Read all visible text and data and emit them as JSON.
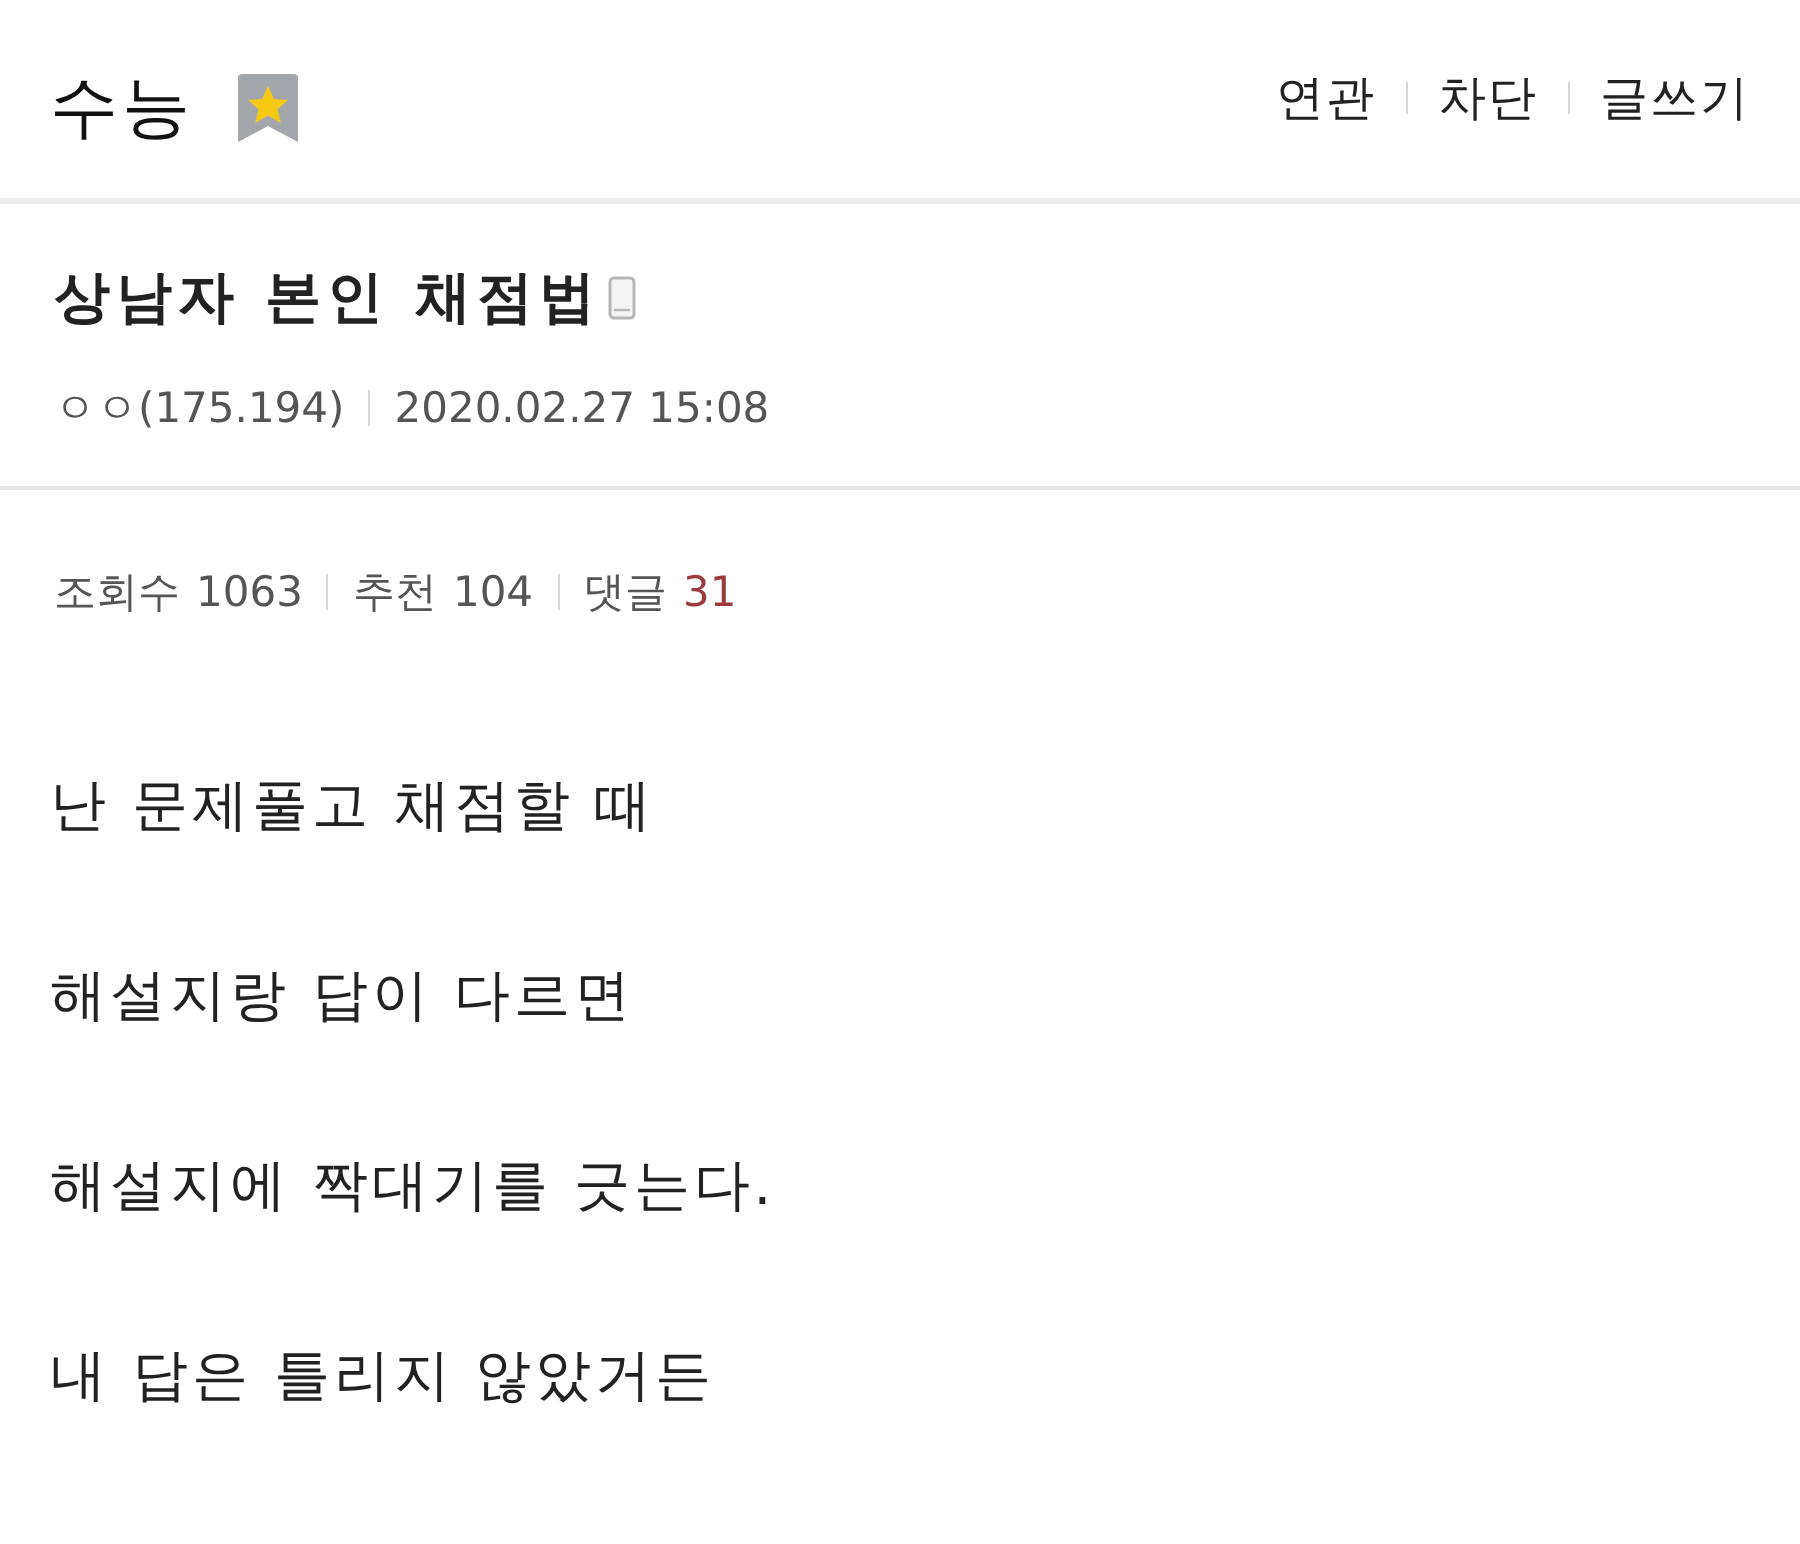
{
  "header": {
    "title": "수능",
    "links": [
      "연관",
      "차단",
      "글쓰기"
    ]
  },
  "post": {
    "title": "상남자 본인 채점법",
    "mobile": true,
    "writer": {
      "nickname": "ㅇㅇ",
      "ip": "(175.194)"
    },
    "date": "2020.02.27 15:08",
    "stats": [
      {
        "kind": "views",
        "label": "조회수",
        "value": "1063"
      },
      {
        "kind": "recommend",
        "label": "추천",
        "value": "104"
      },
      {
        "kind": "comments",
        "label": "댓글",
        "value": "31"
      }
    ],
    "body": [
      "난 문제풀고 채점할 때",
      "해설지랑 답이 다르면",
      "해설지에 짝대기를 긋는다.",
      "내 답은 틀리지 않았거든"
    ]
  }
}
